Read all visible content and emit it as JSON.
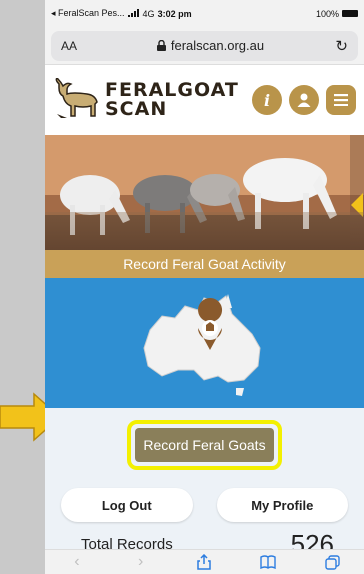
{
  "status": {
    "back_app": "◂ FeralScan Pes...",
    "network": "4G",
    "time": "3:02 pm",
    "battery": "100%"
  },
  "urlbar": {
    "text_size": "AA",
    "url": "feralscan.org.au"
  },
  "header": {
    "logo_line1": "FERALGOAT",
    "logo_line2": "SCAN",
    "info_label": "i"
  },
  "banner": {
    "label": "Record Feral Goat Activity"
  },
  "record_button": {
    "label": "Record Feral Goats"
  },
  "actions": {
    "logout_label": "Log Out",
    "profile_label": "My Profile"
  },
  "totals": {
    "label": "Total Records",
    "value": "526"
  },
  "colors": {
    "accent": "#b9944a",
    "banner": "#c9a158",
    "highlight": "#f3f000",
    "map_bg": "#2f8fd2",
    "ios_blue": "#2d7de0"
  },
  "icons": [
    "lock-icon",
    "reload-icon",
    "info-icon",
    "profile-icon",
    "menu-icon",
    "goat-logo-icon",
    "location-pin-icon",
    "back-icon",
    "forward-icon",
    "share-icon",
    "bookmarks-icon",
    "tabs-icon"
  ]
}
